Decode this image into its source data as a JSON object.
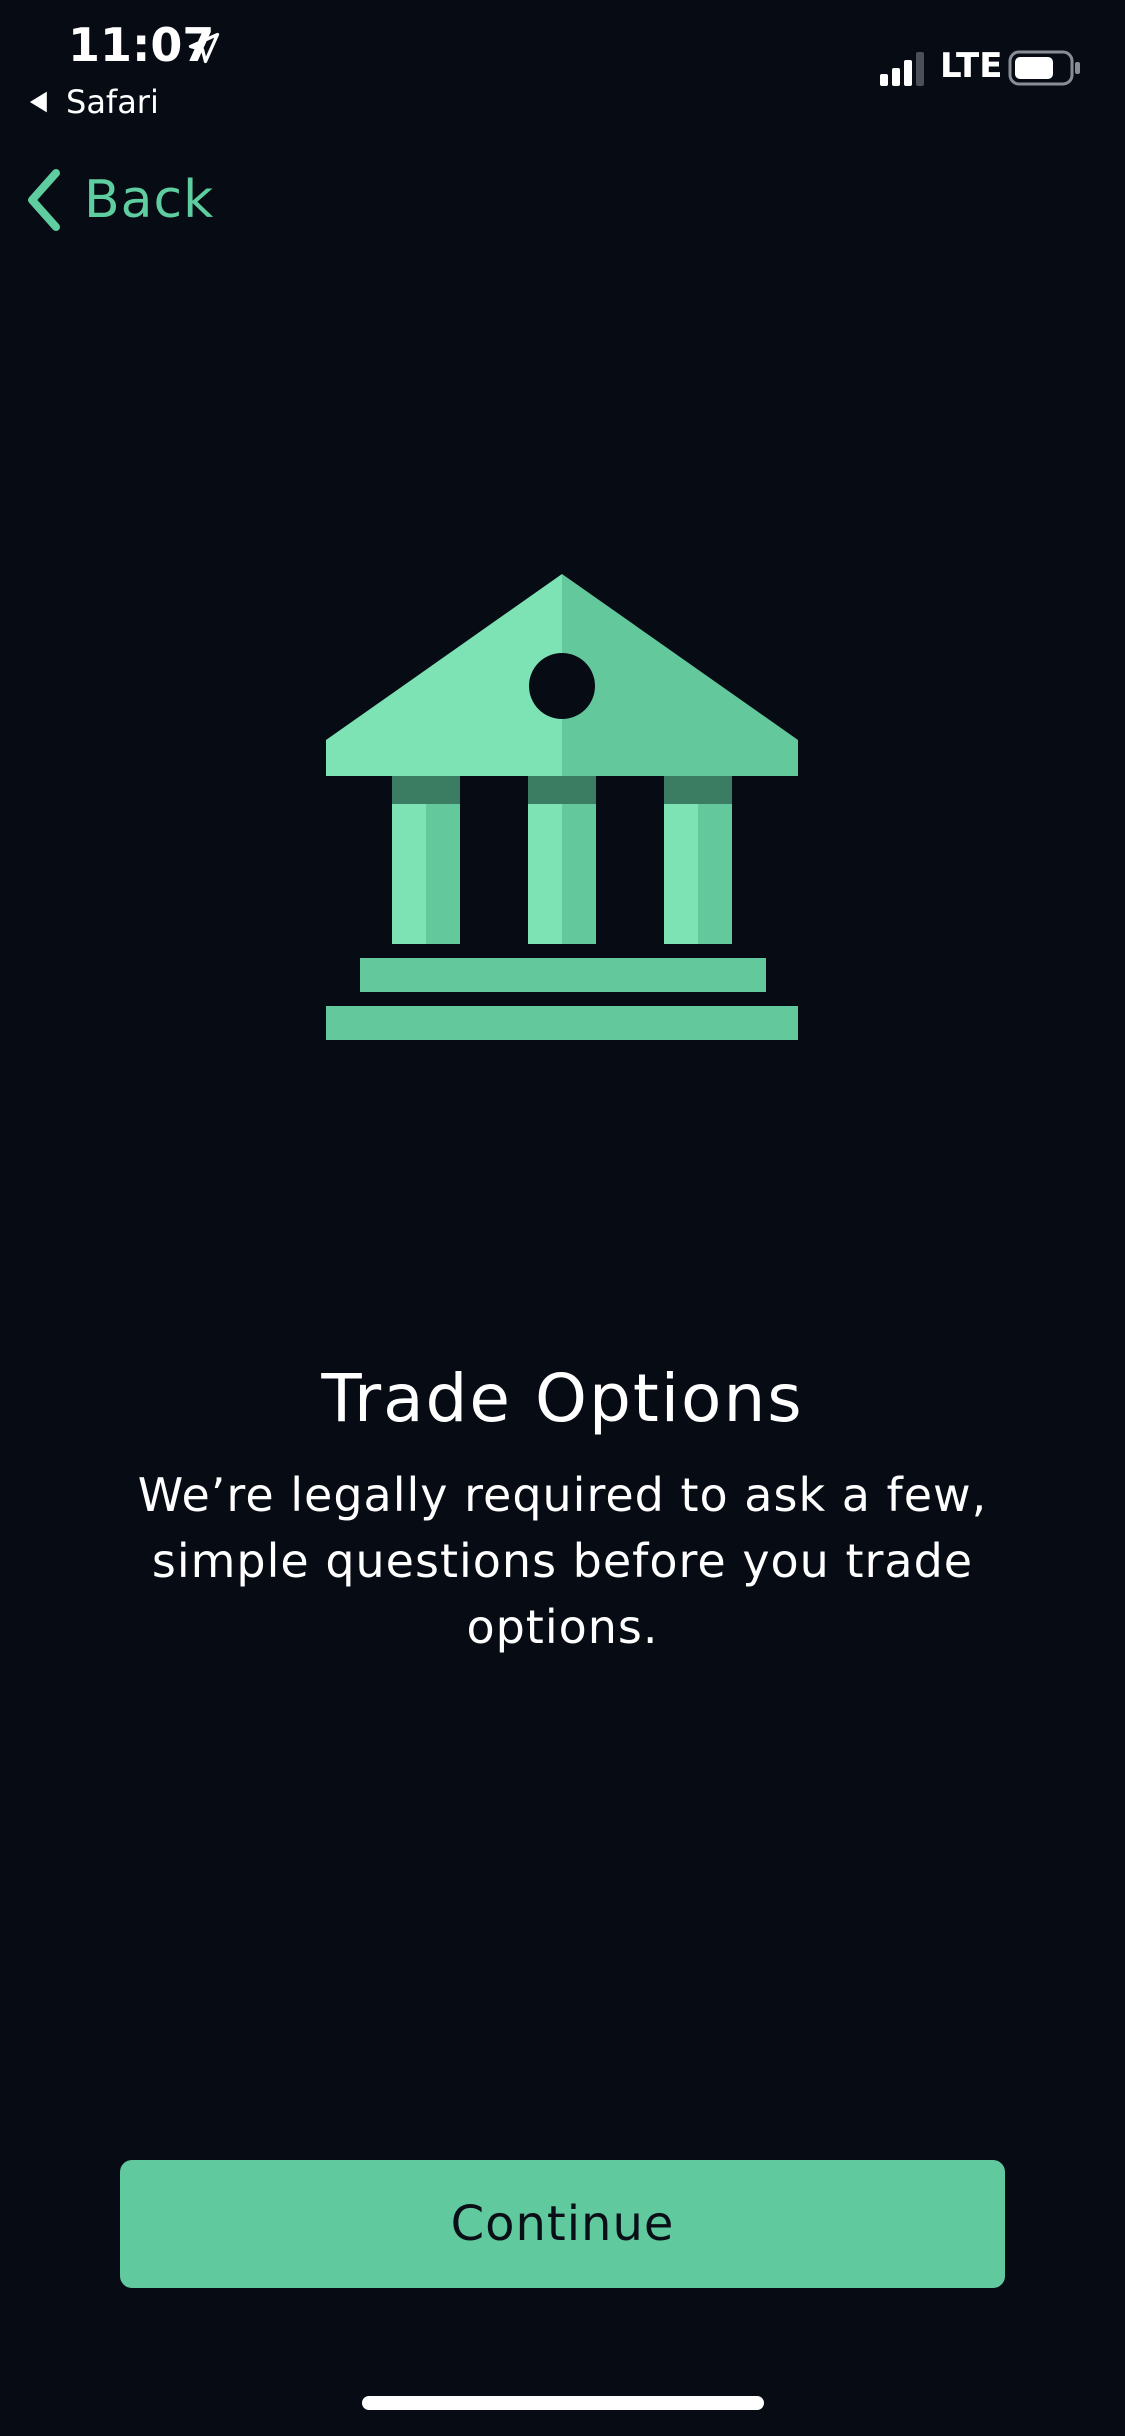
{
  "status_bar": {
    "time": "11:07",
    "back_app": "Safari",
    "network": "LTE"
  },
  "nav": {
    "back_label": "Back"
  },
  "content": {
    "title": "Trade Options",
    "subtitle": "We’re legally required to ask a few, simple questions before you trade options."
  },
  "actions": {
    "continue_label": "Continue"
  },
  "icons": {
    "location": "location-arrow-icon",
    "signal": "cellular-signal-icon",
    "battery": "battery-icon",
    "back": "chevron-left-icon",
    "illustration": "bank-building-icon"
  },
  "colors": {
    "background": "#070c14",
    "accent": "#5ecda0",
    "button": "#60c99d",
    "button_text": "#0a0f17",
    "text": "#ffffff"
  }
}
